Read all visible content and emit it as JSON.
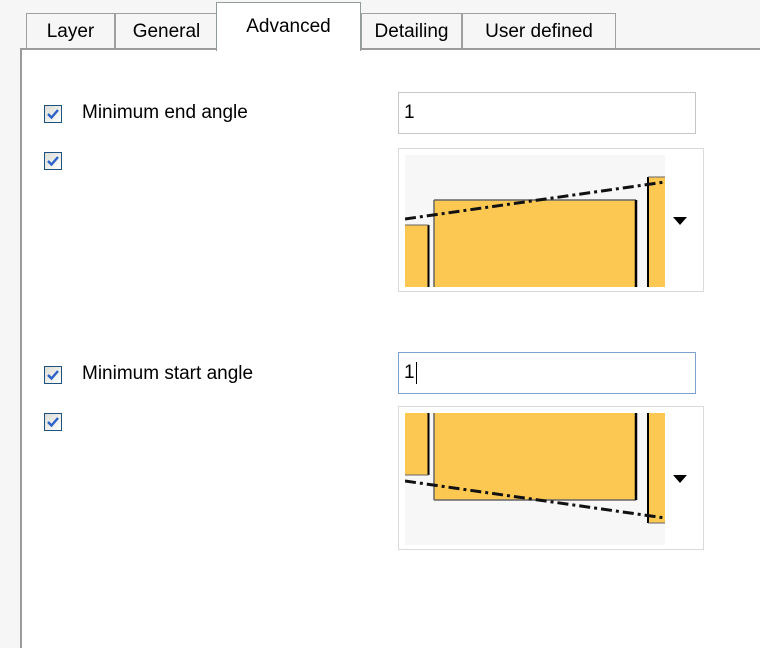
{
  "tabs": [
    {
      "label": "Layer",
      "active": false
    },
    {
      "label": "General",
      "active": false
    },
    {
      "label": "Advanced",
      "active": true
    },
    {
      "label": "Detailing",
      "active": false
    },
    {
      "label": "User defined",
      "active": false
    }
  ],
  "end_angle": {
    "checkbox_checked": true,
    "label": "Minimum end angle",
    "value": "1",
    "option_checkbox_checked": true,
    "dropdown_icon": "chevron-down-icon"
  },
  "start_angle": {
    "checkbox_checked": true,
    "label": "Minimum start angle",
    "value": "1",
    "option_checkbox_checked": true,
    "dropdown_icon": "chevron-down-icon"
  },
  "colors": {
    "fill": "#fdc851",
    "preview_bg": "#f7f7f7",
    "checkbox_border": "#1c5180",
    "check": "#2a62c9"
  }
}
